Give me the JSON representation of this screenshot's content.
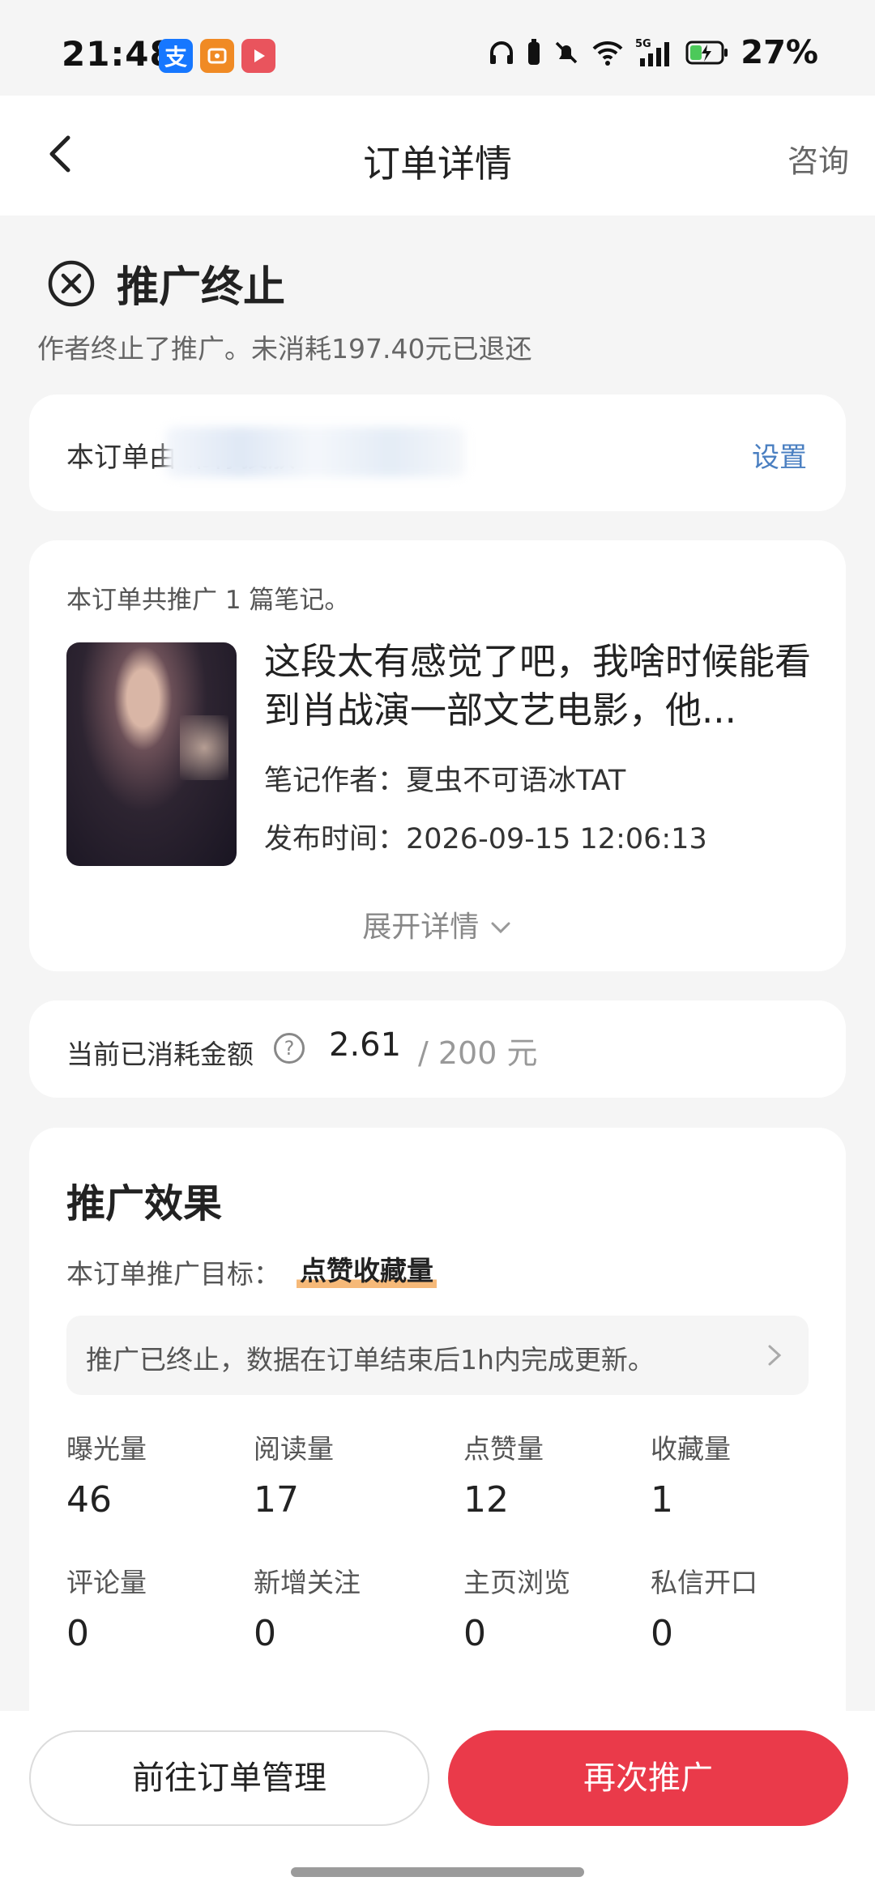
{
  "status_bar": {
    "time": "21:48",
    "battery": "27%",
    "network": "5G"
  },
  "nav": {
    "title": "订单详情",
    "right": "咨询"
  },
  "status": {
    "title": "推广终止",
    "subtitle": "作者终止了推广。未消耗197.40元已退还"
  },
  "delegate": {
    "text": "本订单由                              帮你投放",
    "action": "设置"
  },
  "notes": {
    "count_text": "本订单共推广 1 篇笔记。",
    "title": "这段太有感觉了吧，我啥时候能看到肖战演一部文艺电影，他...",
    "author": "笔记作者：夏虫不可语冰TAT",
    "publish_time": "发布时间：2026-09-15 12:06:13",
    "expand": "展开详情"
  },
  "spend": {
    "label": "当前已消耗金额",
    "value": "2.61",
    "total": "/ 200 元"
  },
  "effect": {
    "title": "推广效果",
    "goal_label": "本订单推广目标：",
    "goal": "点赞收藏量",
    "notice": "推广已终止，数据在订单结束后1h内完成更新。",
    "stats": [
      {
        "label": "曝光量",
        "value": "46"
      },
      {
        "label": "阅读量",
        "value": "17"
      },
      {
        "label": "点赞量",
        "value": "12"
      },
      {
        "label": "收藏量",
        "value": "1"
      },
      {
        "label": "评论量",
        "value": "0"
      },
      {
        "label": "新增关注",
        "value": "0"
      },
      {
        "label": "主页浏览",
        "value": "0"
      },
      {
        "label": "私信开口",
        "value": "0"
      }
    ]
  },
  "bottom": {
    "manage": "前往订单管理",
    "again": "再次推广"
  },
  "colors": {
    "primary": "#ea3a4a",
    "link": "#4a7fc1",
    "highlight": "#f6b978"
  }
}
